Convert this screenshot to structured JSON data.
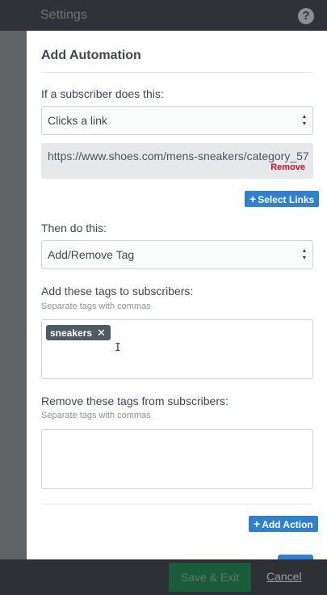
{
  "header": {
    "title": "Settings",
    "help_glyph": "?"
  },
  "panel": {
    "title": "Add Automation",
    "trigger_label": "If a subscriber does this:",
    "trigger_value": "Clicks a link",
    "url": "https://www.shoes.com/mens-sneakers/category_57",
    "remove_label": "Remove",
    "select_links_label": "Select Links",
    "action_label": "Then do this:",
    "action_value": "Add/Remove Tag",
    "add_tags_label": "Add these tags to subscribers:",
    "add_tags_hint": "Separate tags with commas",
    "tags": [
      "sneakers"
    ],
    "remove_tag_glyph": "✕",
    "remove_tags_label": "Remove these tags from subscribers:",
    "remove_tags_hint": "Separate tags with commas",
    "add_action_label": "Add Action"
  },
  "footer": {
    "save_exit_label": "Save & Exit",
    "cancel_label": "Cancel"
  },
  "colors": {
    "primary_button": "#2f80d0",
    "save_button": "#1a5c3a",
    "remove_link": "#c8102e",
    "tag_bg": "#4e5a64"
  },
  "icons": {
    "help": "help-icon",
    "plus": "plus-icon",
    "select_arrows": "select-arrows-icon",
    "text_cursor": "text-cursor-icon"
  }
}
